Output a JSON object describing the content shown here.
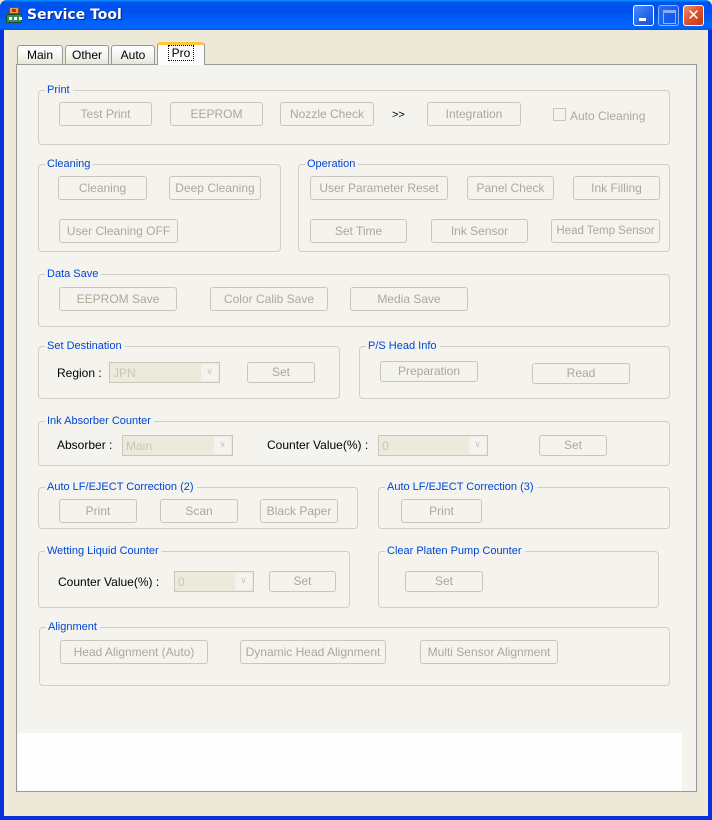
{
  "window": {
    "title": "Service Tool",
    "icons": {
      "app": "printer-app-icon",
      "minimize": "minimize-icon",
      "maximize": "maximize-icon",
      "close": "close-icon"
    },
    "close_glyph": "✕"
  },
  "tabs": [
    {
      "label": "Main",
      "active": false
    },
    {
      "label": "Other",
      "active": false
    },
    {
      "label": "Auto",
      "active": false
    },
    {
      "label": "Pro",
      "active": true
    }
  ],
  "groups": {
    "print": {
      "label": "Print",
      "buttons": [
        "Test Print",
        "EEPROM",
        "Nozzle Check",
        "Integration"
      ],
      "separator": ">>",
      "auto_cleaning": {
        "label": "Auto Cleaning",
        "checked": false
      }
    },
    "cleaning": {
      "label": "Cleaning",
      "buttons": [
        "Cleaning",
        "Deep Cleaning",
        "User Cleaning OFF"
      ]
    },
    "operation": {
      "label": "Operation",
      "buttons": [
        "User Parameter Reset",
        "Panel Check",
        "Ink Filling",
        "Set Time",
        "Ink Sensor",
        "Head Temp Sensor"
      ]
    },
    "data_save": {
      "label": "Data Save",
      "buttons": [
        "EEPROM Save",
        "Color Calib Save",
        "Media Save"
      ]
    },
    "set_destination": {
      "label": "Set Destination",
      "region_label": "Region :",
      "region_value": "JPN",
      "set_button": "Set"
    },
    "ps_head_info": {
      "label": "P/S Head Info",
      "buttons": [
        "Preparation",
        "Read"
      ]
    },
    "ink_absorber": {
      "label": "Ink Absorber Counter",
      "absorber_label": "Absorber :",
      "absorber_value": "Main",
      "counter_label": "Counter Value(%) :",
      "counter_value": "0",
      "set_button": "Set"
    },
    "auto_lf_2": {
      "label": "Auto LF/EJECT Correction (2)",
      "buttons": [
        "Print",
        "Scan",
        "Black Paper"
      ]
    },
    "auto_lf_3": {
      "label": "Auto LF/EJECT Correction (3)",
      "buttons": [
        "Print"
      ]
    },
    "wetting": {
      "label": "Wetting Liquid Counter",
      "counter_label": "Counter Value(%) :",
      "counter_value": "0",
      "set_button": "Set"
    },
    "clear_platen": {
      "label": "Clear Platen Pump Counter",
      "set_button": "Set"
    },
    "alignment": {
      "label": "Alignment",
      "buttons": [
        "Head Alignment (Auto)",
        "Dynamic Head Alignment",
        "Multi Sensor Alignment"
      ]
    }
  },
  "combo_arrow_glyph": "∨"
}
